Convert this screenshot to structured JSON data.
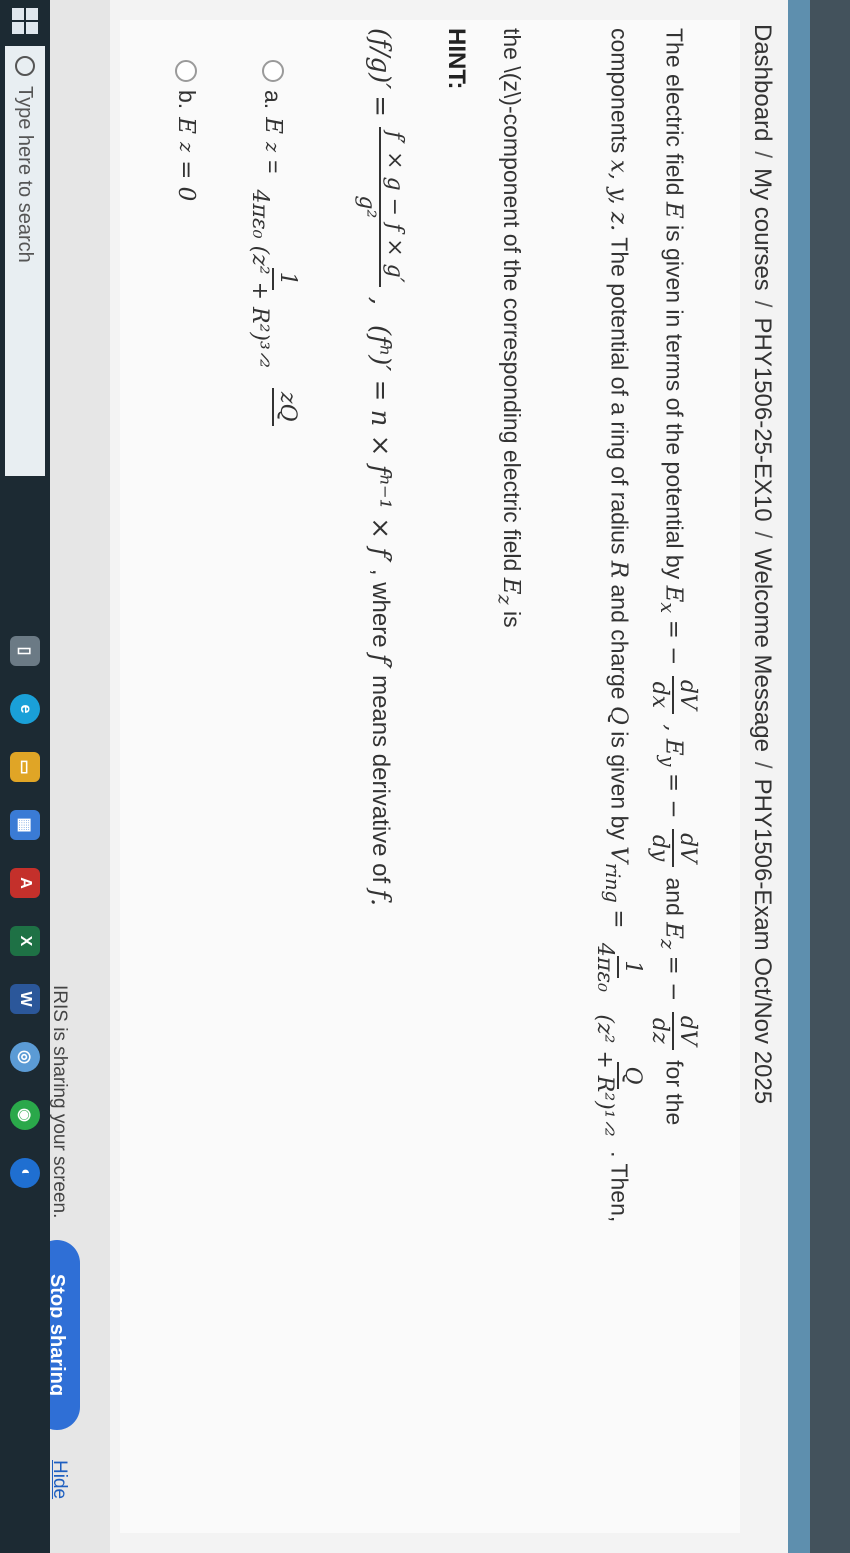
{
  "breadcrumb": {
    "items": [
      "Dashboard",
      "My courses",
      "PHY1506-25-EX10",
      "Welcome Message",
      "PHY1506-Exam Oct/Nov 2025"
    ],
    "separator": "/"
  },
  "question": {
    "line1_part1": "The electric field",
    "line1_E": "E",
    "line1_part2": "is given in terms of the potential by",
    "line1_Ex": "E",
    "line1_Ex_sub": "x",
    "line1_eq": "= −",
    "frac_x_num": "dV",
    "frac_x_den": "dx",
    "line1_Ey": ", E",
    "line1_Ey_sub": "y",
    "frac_y_num": "dV",
    "frac_y_den": "dy",
    "line1_and": "and",
    "line1_Ez": "E",
    "line1_Ez_sub": "z",
    "frac_z_num": "dV",
    "frac_z_den": "dz",
    "line1_end": "for the",
    "line2_part1": "components",
    "line2_vars": "x, y, z.",
    "line2_part2": "The potential of a ring of radius",
    "line2_R": "R",
    "line2_part3": "and charge",
    "line2_Q": "Q",
    "line2_part4": "is given by",
    "line2_V": "V",
    "line2_V_sub": "ring",
    "ring_frac1_num": "1",
    "ring_frac1_den": "4πε₀",
    "ring_frac2_num": "Q",
    "ring_frac2_den": "(z² + R²)¹ᐟ²",
    "line2_end": ". Then,",
    "line3_part1": "the \\(z\\)-component of the corresponding electric field",
    "line3_E": "E",
    "line3_E_sub": "z",
    "line3_end": "is"
  },
  "hint": {
    "label": "HINT:",
    "lhs": "(f/g)′",
    "eq": "=",
    "num": "f′ × g − f × g′",
    "den": "g²",
    "comma": ",",
    "rule2": "(fⁿ)′ = n × fⁿ⁻¹ × f′",
    "where": ", where",
    "fprime": "f′",
    "means": "means derivative of",
    "f": "f."
  },
  "options": [
    {
      "letter": "a.",
      "prefix": "E",
      "sub": "z",
      "eq": "=",
      "num": "1",
      "den": "4πε₀ (z² + R²)³ᐟ²",
      "num2": "zQ"
    },
    {
      "letter": "b.",
      "text": "E",
      "sub": "z",
      "rest": "= 0"
    }
  ],
  "sharing": {
    "message": "IRIS is sharing your screen.",
    "stop_label": "Stop sharing",
    "hide_label": "Hide"
  },
  "taskbar": {
    "search_placeholder": "Type here to search"
  },
  "colors": {
    "accent": "#5e8fae",
    "stop_button": "#2f6fd6",
    "taskbar": "#1c2a33"
  }
}
